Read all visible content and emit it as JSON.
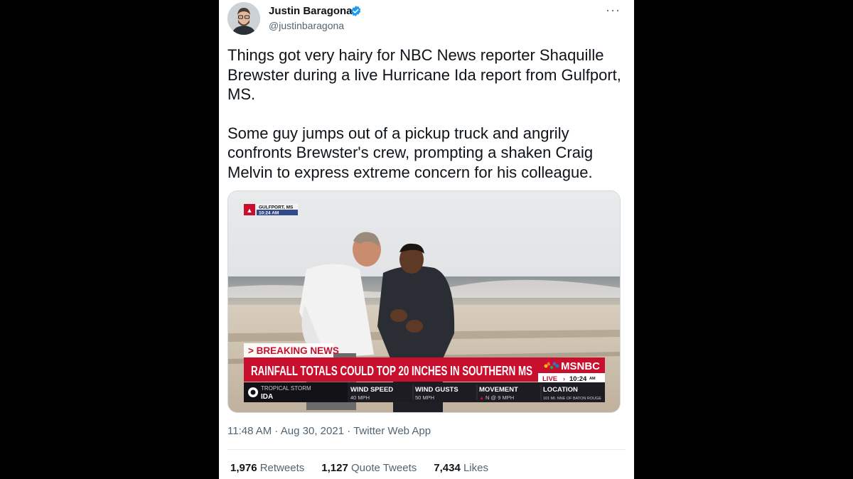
{
  "author": {
    "name": "Justin Baragona",
    "handle": "@justinbaragona"
  },
  "more_label": "···",
  "tweet": {
    "paragraph1": "Things got very hairy for NBC News reporter Shaquille Brewster during a live Hurricane Ida report from Gulfport, MS.",
    "paragraph2": "Some guy jumps out of a pickup truck and angrily confronts Brewster's crew, prompting a shaken Craig Melvin to express extreme concern for his colleague."
  },
  "video": {
    "location_bug": "GULFPORT, MS",
    "time_bug": "10:24 AM",
    "breaking_label": "> BREAKING NEWS",
    "headline": "RAINFALL TOTALS COULD TOP 20 INCHES IN SOUTHERN MS",
    "network": "MSNBC",
    "live_label": "LIVE",
    "live_time": "10:24",
    "live_ampm": "AM",
    "storm_type": "TROPICAL STORM",
    "storm_name": "IDA",
    "stats": [
      {
        "label": "WIND SPEED",
        "value": "40 MPH"
      },
      {
        "label": "WIND GUSTS",
        "value": "50 MPH"
      },
      {
        "label": "MOVEMENT",
        "value": "N @ 9 MPH"
      },
      {
        "label": "LOCATION",
        "value": "101 MI. NNE OF BATON ROUGE"
      }
    ],
    "colors": {
      "banner_red": "#c8102e",
      "dark": "#1c1c22"
    }
  },
  "meta": {
    "time": "11:48 AM",
    "date": "Aug 30, 2021",
    "source": "Twitter Web App",
    "sep": " · "
  },
  "stats": {
    "retweets_count": "1,976",
    "retweets_label": "Retweets",
    "quotes_count": "1,127",
    "quotes_label": "Quote Tweets",
    "likes_count": "7,434",
    "likes_label": "Likes"
  }
}
